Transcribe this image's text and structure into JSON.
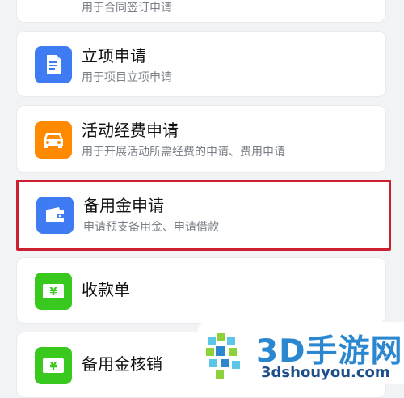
{
  "colors": {
    "orange": "#ff8a00",
    "blue": "#3f7bf2",
    "green": "#39c91e",
    "highlight": "#cc1f2f",
    "watermark_blue": "#2b87cf"
  },
  "items": [
    {
      "title": "",
      "subtitle": "用于合同签订申请",
      "icon": "contract-icon",
      "icon_color": "#ff8a00"
    },
    {
      "title": "立项申请",
      "subtitle": "用于项目立项申请",
      "icon": "document-icon",
      "icon_color": "#3f7bf2"
    },
    {
      "title": "活动经费申请",
      "subtitle": "用于开展活动所需经费的申请、费用申请",
      "icon": "car-icon",
      "icon_color": "#ff8a00"
    },
    {
      "title": "备用金申请",
      "subtitle": "申请预支备用金、申请借款",
      "icon": "wallet-icon",
      "icon_color": "#3f7bf2"
    },
    {
      "title": "收款单",
      "subtitle": "",
      "icon": "yuan-icon",
      "icon_color": "#39c91e"
    },
    {
      "title": "备用金核销",
      "subtitle": "",
      "icon": "yuan-icon",
      "icon_color": "#39c91e"
    }
  ],
  "watermark": {
    "name": "3D手游网",
    "domain": "3dshouyou.com"
  }
}
